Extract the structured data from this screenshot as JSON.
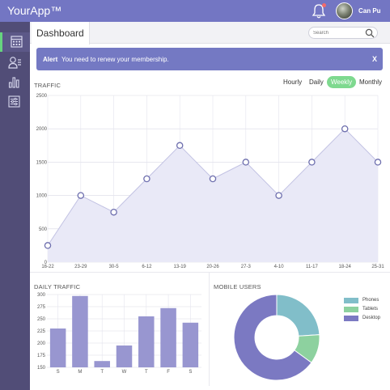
{
  "app": {
    "title": "YourApp™",
    "user_name": "Can Pu"
  },
  "tab": {
    "label": "Dashboard"
  },
  "search": {
    "placeholder": "Search"
  },
  "alert": {
    "title": "Alert",
    "message": "You need to renew your membership.",
    "close_label": "X"
  },
  "traffic": {
    "title": "TRAFFIC",
    "ranges": [
      "Hourly",
      "Daily",
      "Weekly",
      "Monthly"
    ],
    "active_range": "Weekly"
  },
  "daily_traffic": {
    "title": "DAILY TRAFFIC"
  },
  "mobile_users": {
    "title": "MOBILE USERS"
  },
  "colors": {
    "accent": "#7376c3",
    "sidebar": "#514d77",
    "active_green": "#7ed98f",
    "bar": "#9896d0",
    "area_fill": "#e9e9f7",
    "line": "#c2c2e3",
    "desktop": "#7b79c2",
    "phones": "#81bec9",
    "tablets": "#8dd19f"
  },
  "chart_data": [
    {
      "type": "area",
      "categories": [
        "16-22",
        "23-29",
        "30-5",
        "6-12",
        "13-19",
        "20-26",
        "27-3",
        "4-10",
        "11-17",
        "18-24",
        "25-31"
      ],
      "values": [
        250,
        1000,
        750,
        1250,
        1750,
        1250,
        1500,
        1000,
        1500,
        2000,
        1500
      ],
      "ylim": [
        0,
        2500
      ],
      "yticks": [
        0,
        500,
        1000,
        1500,
        2000,
        2500
      ],
      "grid": true
    },
    {
      "type": "bar",
      "categories": [
        "S",
        "M",
        "T",
        "W",
        "T",
        "F",
        "S"
      ],
      "values": [
        230,
        297,
        163,
        195,
        255,
        272,
        242
      ],
      "ylim": [
        150,
        300
      ],
      "yticks": [
        150,
        175,
        200,
        225,
        250,
        275,
        300
      ],
      "grid": true
    },
    {
      "type": "pie",
      "donut": true,
      "legend_position": "right",
      "series": [
        {
          "name": "Phones",
          "value": 24
        },
        {
          "name": "Tablets",
          "value": 11
        },
        {
          "name": "Desktop",
          "value": 65
        }
      ]
    }
  ]
}
